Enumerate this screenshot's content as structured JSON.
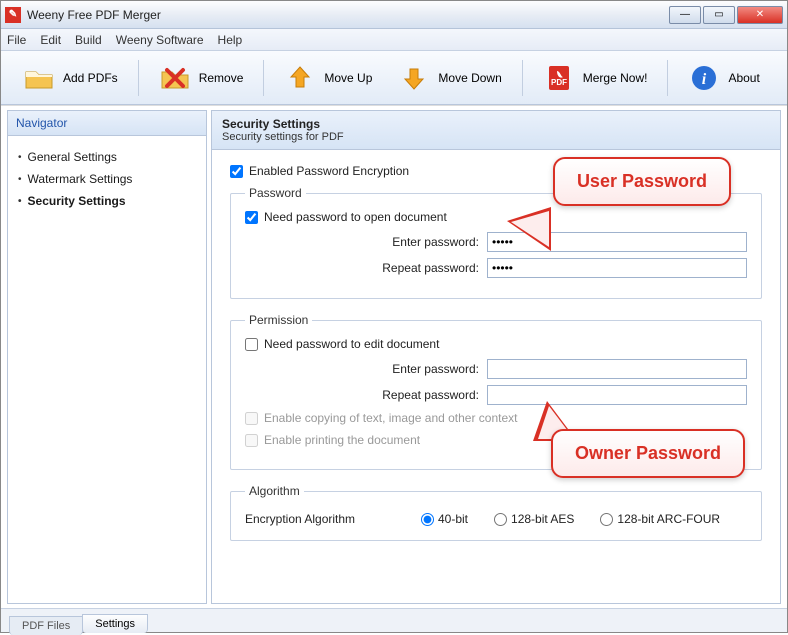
{
  "window": {
    "title": "Weeny Free PDF Merger"
  },
  "menu": [
    "File",
    "Edit",
    "Build",
    "Weeny Software",
    "Help"
  ],
  "toolbar": {
    "add": "Add PDFs",
    "remove": "Remove",
    "moveup": "Move Up",
    "movedown": "Move Down",
    "merge": "Merge Now!",
    "about": "About"
  },
  "sidebar": {
    "header": "Navigator",
    "items": [
      "General Settings",
      "Watermark Settings",
      "Security Settings"
    ],
    "active_index": 2
  },
  "content": {
    "title": "Security Settings",
    "subtitle": "Security settings for PDF",
    "enable_encryption_label": "Enabled Password Encryption",
    "enable_encryption_checked": true,
    "password_group": {
      "legend": "Password",
      "need_open_label": "Need password to open document",
      "need_open_checked": true,
      "enter_label": "Enter password:",
      "repeat_label": "Repeat password:",
      "enter_value": "•••••",
      "repeat_value": "•••••"
    },
    "permission_group": {
      "legend": "Permission",
      "need_edit_label": "Need password to edit document",
      "need_edit_checked": false,
      "enter_label": "Enter password:",
      "repeat_label": "Repeat password:",
      "enter_value": "",
      "repeat_value": "",
      "enable_copy_label": "Enable copying of text, image and other context",
      "enable_copy_checked": false,
      "enable_print_label": "Enable printing the document",
      "enable_print_checked": false
    },
    "algorithm_group": {
      "legend": "Algorithm",
      "label": "Encryption Algorithm",
      "options": [
        "40-bit",
        "128-bit AES",
        "128-bit ARC-FOUR"
      ],
      "selected_index": 0
    }
  },
  "bottom_tabs": {
    "tab1": "PDF Files",
    "tab2": "Settings",
    "active_index": 1
  },
  "callouts": {
    "user": "User Password",
    "owner": "Owner Password"
  }
}
